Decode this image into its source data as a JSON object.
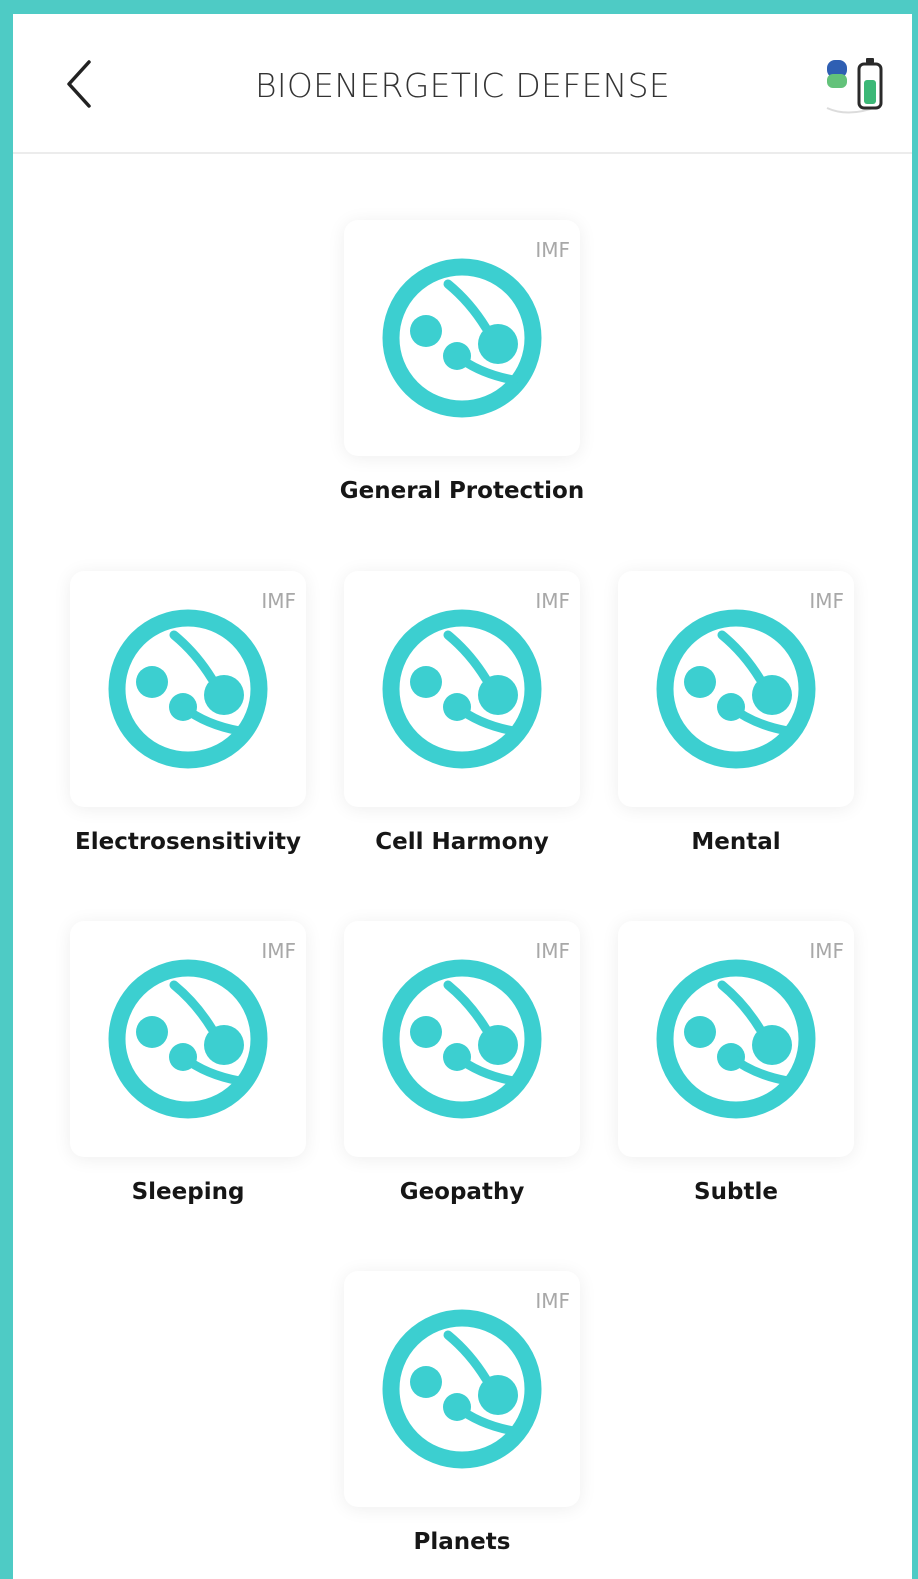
{
  "header": {
    "title": "BIOENERGETIC DEFENSE",
    "back_icon": "chevron-left-icon",
    "device_icon": "device-battery-icon"
  },
  "colors": {
    "accent": "#3ccfd0",
    "frame": "#4ecbc5",
    "badge": "#a8a8a8"
  },
  "programs": [
    {
      "label": "General Protection",
      "badge": "IMF"
    },
    {
      "label": "Electrosensitivity",
      "badge": "IMF"
    },
    {
      "label": "Cell Harmony",
      "badge": "IMF"
    },
    {
      "label": "Mental",
      "badge": "IMF"
    },
    {
      "label": "Sleeping",
      "badge": "IMF"
    },
    {
      "label": "Geopathy",
      "badge": "IMF"
    },
    {
      "label": "Subtle",
      "badge": "IMF"
    },
    {
      "label": "Planets",
      "badge": "IMF"
    }
  ]
}
